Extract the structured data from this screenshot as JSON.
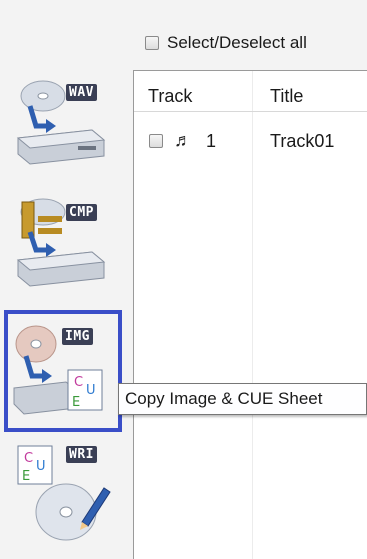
{
  "sidebar": {
    "tools": [
      {
        "badge": "WAV"
      },
      {
        "badge": "CMP"
      },
      {
        "badge": "IMG"
      },
      {
        "badge": "WRI"
      }
    ]
  },
  "toolbar": {
    "select_all_label": "Select/Deselect all"
  },
  "table": {
    "columns": [
      "Track",
      "Title"
    ],
    "rows": [
      {
        "track": "1",
        "title": "Track01",
        "icon": "music-note-icon"
      }
    ]
  },
  "tooltip": {
    "text": "Copy Image & CUE Sheet"
  },
  "colors": {
    "active_outline": "#3a4ec8",
    "badge_bg": "#3a3f55",
    "background": "#f3f3f3"
  }
}
